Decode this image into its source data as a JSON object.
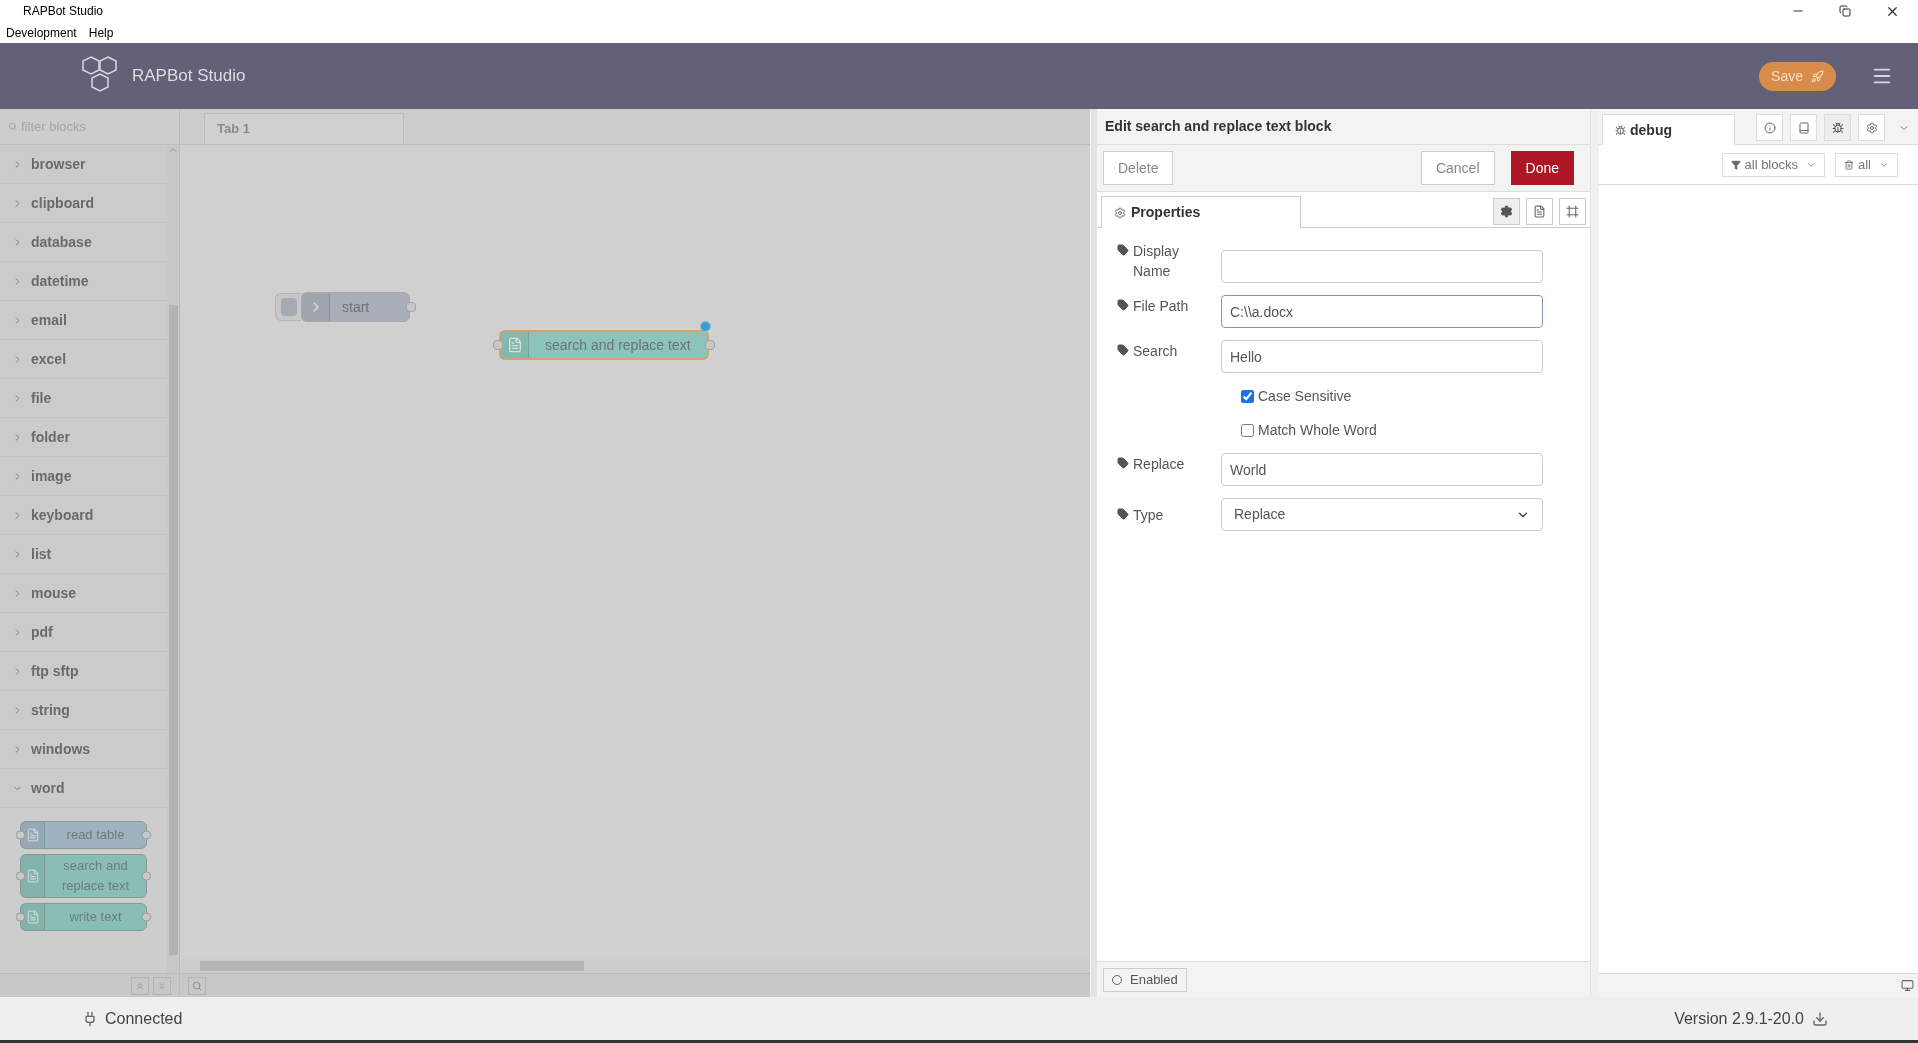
{
  "window": {
    "title": "RAPBot Studio",
    "menu": [
      "Development",
      "Help"
    ]
  },
  "header": {
    "title": "RAPBot Studio",
    "save": "Save"
  },
  "palette": {
    "placeholder": "filter blocks",
    "categories": [
      {
        "label": "browser",
        "expanded": false
      },
      {
        "label": "clipboard",
        "expanded": false
      },
      {
        "label": "database",
        "expanded": false
      },
      {
        "label": "datetime",
        "expanded": false
      },
      {
        "label": "email",
        "expanded": false
      },
      {
        "label": "excel",
        "expanded": false
      },
      {
        "label": "file",
        "expanded": false
      },
      {
        "label": "folder",
        "expanded": false
      },
      {
        "label": "image",
        "expanded": false
      },
      {
        "label": "keyboard",
        "expanded": false
      },
      {
        "label": "list",
        "expanded": false
      },
      {
        "label": "mouse",
        "expanded": false
      },
      {
        "label": "pdf",
        "expanded": false
      },
      {
        "label": "ftp sftp",
        "expanded": false
      },
      {
        "label": "string",
        "expanded": false
      },
      {
        "label": "windows",
        "expanded": false
      },
      {
        "label": "word",
        "expanded": true,
        "blocks": [
          {
            "label": "read table",
            "color": "#9fb2bf"
          },
          {
            "label": "search and replace text",
            "color": "#89beb5"
          },
          {
            "label": "write text",
            "color": "#89beb5"
          }
        ]
      }
    ]
  },
  "canvas": {
    "tabs": [
      {
        "label": "Tab 1",
        "selected": true
      }
    ],
    "nodes": [
      {
        "label": "start",
        "kind": "inject",
        "selected": false
      },
      {
        "label": "search and replace text",
        "kind": "word",
        "selected": true,
        "changed": true
      }
    ]
  },
  "editor": {
    "title": "Edit search and replace text block",
    "delete": "Delete",
    "cancel": "Cancel",
    "done": "Done",
    "tab": "Properties",
    "fields": [
      {
        "kind": "text",
        "label": "Display Name",
        "focused": false
      },
      {
        "kind": "text",
        "label": "File Path",
        "value": "C:\\\\a.docx",
        "focused": true
      },
      {
        "kind": "text",
        "label": "Search",
        "value": "Hello",
        "focused": false
      },
      {
        "kind": "checkbox",
        "label": "Case Sensitive",
        "checked": true
      },
      {
        "kind": "checkbox",
        "label": "Match Whole Word",
        "checked": false
      },
      {
        "kind": "text",
        "label": "Replace",
        "value": "World",
        "focused": false
      },
      {
        "kind": "select",
        "label": "Type",
        "value": "Replace"
      }
    ],
    "enabled": "Enabled"
  },
  "sidebar": {
    "tab": "debug",
    "filter": "all blocks",
    "clear": "all"
  },
  "status": {
    "connection": "Connected",
    "version": "Version 2.9.1-20.0"
  }
}
